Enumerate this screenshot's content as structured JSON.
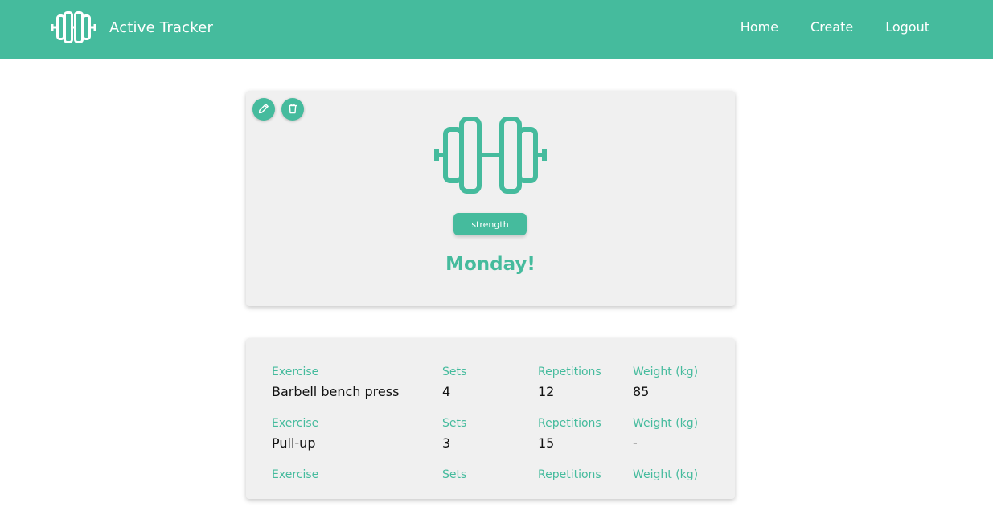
{
  "header": {
    "app_title": "Active Tracker",
    "logo_icon": "dumbbell-icon",
    "nav": [
      {
        "label": "Home"
      },
      {
        "label": "Create"
      },
      {
        "label": "Logout"
      }
    ],
    "color": "#45bb9d"
  },
  "workout": {
    "category": "strength",
    "title": "Monday!",
    "icon": "dumbbell-icon",
    "actions": {
      "edit_icon": "pencil-icon",
      "delete_icon": "trash-icon"
    }
  },
  "exercises": {
    "headers": {
      "exercise": "Exercise",
      "sets": "Sets",
      "repetitions": "Repetitions",
      "weight": "Weight (kg)"
    },
    "rows": [
      {
        "exercise": "Barbell bench press",
        "sets": "4",
        "repetitions": "12",
        "weight": "85"
      },
      {
        "exercise": "Pull-up",
        "sets": "3",
        "repetitions": "15",
        "weight": "-"
      },
      {
        "exercise": "",
        "sets": "",
        "repetitions": "",
        "weight": ""
      }
    ]
  }
}
